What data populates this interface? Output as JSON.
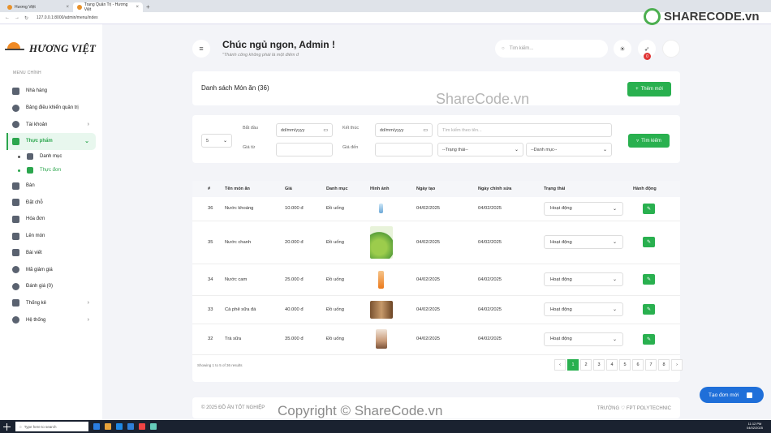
{
  "browser": {
    "tabs": [
      {
        "title": "Hương Việt"
      },
      {
        "title": "Trang Quản Trị - Hương Việt"
      }
    ],
    "url": "127.0.0.1:8000/admin/menu/index"
  },
  "sidebar": {
    "brand": "HƯƠNG VIỆT",
    "menu_title": "MENU CHÍNH",
    "items": [
      {
        "label": "Nhà hàng",
        "icon": "home-icon"
      },
      {
        "label": "Bảng điều khiển quản trị",
        "icon": "dashboard-icon"
      },
      {
        "label": "Tài khoản",
        "icon": "users-icon"
      },
      {
        "label": "Thực phẩm",
        "icon": "utensils-icon"
      },
      {
        "label": "Danh mục",
        "icon": "list-icon"
      },
      {
        "label": "Thực đơn",
        "icon": "fork-knife-icon"
      },
      {
        "label": "Bàn",
        "icon": "table-icon"
      },
      {
        "label": "Đặt chỗ",
        "icon": "calendar-icon"
      },
      {
        "label": "Hóa đơn",
        "icon": "invoice-icon"
      },
      {
        "label": "Lên món",
        "icon": "serve-icon"
      },
      {
        "label": "Bài viết",
        "icon": "post-icon"
      },
      {
        "label": "Mã giảm giá",
        "icon": "discount-icon"
      },
      {
        "label": "Đánh giá (0)",
        "icon": "comments-icon"
      },
      {
        "label": "Thống kê",
        "icon": "chart-icon"
      },
      {
        "label": "Hệ thống",
        "icon": "cogs-icon"
      }
    ]
  },
  "header": {
    "greeting": "Chúc ngủ ngon, Admin !",
    "quote": "\"Thành công không phải là một điểm đ",
    "search_placeholder": "Tìm kiếm...",
    "notification_count": "0"
  },
  "list": {
    "title": "Danh sách Món ăn (36)",
    "add_button": "Thêm mới"
  },
  "filters": {
    "page_size": "5",
    "start_label": "Bắt đầu",
    "end_label": "Kết thúc",
    "price_from_label": "Giá từ",
    "price_to_label": "Giá đến",
    "date_placeholder": "dd/mm/yyyy",
    "name_placeholder": "Tìm kiếm theo tên...",
    "status_placeholder": "--Trạng thái--",
    "category_placeholder": "--Danh mục--",
    "search_button": "Tìm kiếm"
  },
  "table": {
    "columns": [
      "#",
      "Tên món ăn",
      "Giá",
      "Danh mục",
      "Hình ảnh",
      "Ngày tạo",
      "Ngày chỉnh sửa",
      "Trạng thái",
      "Hành động"
    ],
    "rows": [
      {
        "id": "36",
        "name": "Nước khoáng",
        "price": "10.000 đ",
        "category": "Đồ uống",
        "created": "04/02/2025",
        "updated": "04/02/2025",
        "status": "Hoạt động",
        "image": "water-bottle"
      },
      {
        "id": "35",
        "name": "Nước chanh",
        "price": "20.000 đ",
        "category": "Đồ uống",
        "created": "04/02/2025",
        "updated": "04/02/2025",
        "status": "Hoạt động",
        "image": "lemonade"
      },
      {
        "id": "34",
        "name": "Nước cam",
        "price": "25.000 đ",
        "category": "Đồ uống",
        "created": "04/02/2025",
        "updated": "04/02/2025",
        "status": "Hoạt động",
        "image": "orange-juice"
      },
      {
        "id": "33",
        "name": "Cà phê sữa đá",
        "price": "40.000 đ",
        "category": "Đồ uống",
        "created": "04/02/2025",
        "updated": "04/02/2025",
        "status": "Hoạt động",
        "image": "iced-coffee"
      },
      {
        "id": "32",
        "name": "Trà sữa",
        "price": "35.000 đ",
        "category": "Đồ uống",
        "created": "04/02/2025",
        "updated": "04/02/2025",
        "status": "Hoạt động",
        "image": "milk-tea"
      }
    ],
    "showing": "Showing 1 to 5 of 36 results",
    "pages": [
      "‹",
      "1",
      "2",
      "3",
      "4",
      "5",
      "6",
      "7",
      "8",
      "›"
    ],
    "current_page": "1"
  },
  "footer": {
    "left": "© 2025 ĐỒ ÁN TỐT NGHIỆP",
    "right": "TRƯỜNG ♡ FPT POLYTECHNIC"
  },
  "float_button": "Tạo đơn mới",
  "watermarks": {
    "logo": "SHARECODE.vn",
    "middle": "ShareCode.vn",
    "bottom": "Copyright © ShareCode.vn"
  },
  "taskbar": {
    "search_placeholder": "Type here to search",
    "time": "11:12 PM",
    "date": "04/02/2025"
  },
  "colors": {
    "accent": "#29b04f",
    "primary": "#1f6fd9",
    "badge": "#e03434"
  }
}
